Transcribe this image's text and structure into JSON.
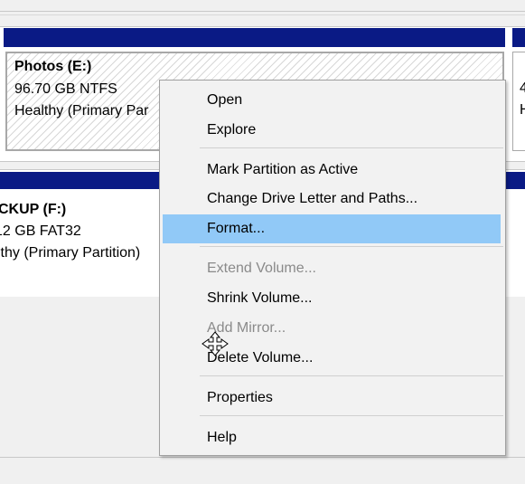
{
  "disk_upper": {
    "volume_name": "Photos  (E:)",
    "size_fs": "96.70 GB NTFS",
    "status": "Healthy (Primary Par",
    "right_partial_1": "4",
    "right_partial_2": "H"
  },
  "disk_lower": {
    "volume_name": "CKUP  (F:)",
    "size_fs": "12 GB FAT32",
    "status": "lthy (Primary Partition)"
  },
  "context_menu": {
    "open": "Open",
    "explore": "Explore",
    "mark_active": "Mark Partition as Active",
    "change_letter": "Change Drive Letter and Paths...",
    "format": "Format...",
    "extend": "Extend Volume...",
    "shrink": "Shrink Volume...",
    "add_mirror": "Add Mirror...",
    "delete": "Delete Volume...",
    "properties": "Properties",
    "help": "Help"
  },
  "colors": {
    "disk_bar": "#0a1a85",
    "menu_highlight": "#91c9f7",
    "disabled_text": "#8a8a8a"
  },
  "icons": {
    "cursor": "move-cursor-icon"
  }
}
